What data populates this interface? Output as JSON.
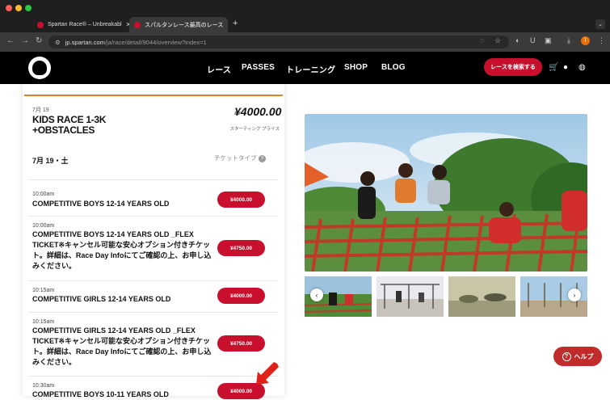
{
  "browser": {
    "tabs": [
      {
        "title": "Spartan Race® – Unbreakabl"
      },
      {
        "title": "スパルタンレース最高のレース"
      }
    ],
    "new_tab": "+",
    "url_host": "jp.spartan.com",
    "url_path": "/ja/race/detail/9044/overview?index=1",
    "profile_initial": "T"
  },
  "site": {
    "menu": [
      "レース",
      "PASSES",
      "トレーニング",
      "SHOP",
      "BLOG"
    ],
    "search_button": "レースを検索する",
    "colors": {
      "accent": "#c8102e",
      "nav_bg": "#000000",
      "orange": "#e77f24"
    }
  },
  "race": {
    "date_small": "7月 19",
    "title": "KIDS RACE 1-3K +OBSTACLES",
    "price": "¥4000.00",
    "price_label": "スターティング プライス",
    "date_line": "7月 19・土",
    "ticket_type": "チケットタイプ",
    "help": "?"
  },
  "events": [
    {
      "time": "10:00am",
      "name": "COMPETITIVE BOYS 12-14 YEARS OLD",
      "price": "¥4000.00"
    },
    {
      "time": "10:00am",
      "name": "COMPETITIVE BOYS 12-14 YEARS OLD _FLEX TICKET※キャンセル可能な安心オプション付きチケット。詳細は、Race Day Infoにてご確認の上、お申し込みください。",
      "price": "¥4750.00"
    },
    {
      "time": "10:15am",
      "name": "COMPETITIVE GIRLS 12-14 YEARS OLD",
      "price": "¥4000.00"
    },
    {
      "time": "10:15am",
      "name": "COMPETITIVE GIRLS 12-14 YEARS OLD _FLEX TICKET※キャンセル可能な安心オプション付きチケット。詳細は、Race Day Infoにてご確認の上、お申し込みください。",
      "price": "¥4750.00"
    },
    {
      "time": "10:30am",
      "name": "COMPETITIVE BOYS 10-11 YEARS OLD",
      "price": "¥4000.00"
    }
  ],
  "gallery": {
    "prev": "‹",
    "next": "›"
  },
  "help_widget": {
    "label": "ヘルプ",
    "icon": "?"
  }
}
